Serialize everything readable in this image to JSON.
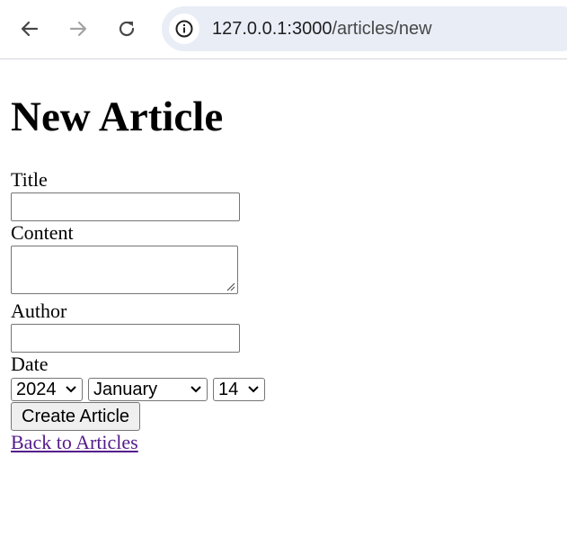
{
  "browser": {
    "url_host": "127.0.0.1:3000",
    "url_path": "/articles/new",
    "icons": {
      "back": "arrow-left-icon",
      "forward": "arrow-right-icon",
      "reload": "reload-icon",
      "site_info": "info-icon"
    }
  },
  "page": {
    "heading": "New Article",
    "form": {
      "title_label": "Title",
      "title_value": "",
      "content_label": "Content",
      "content_value": "",
      "author_label": "Author",
      "author_value": "",
      "date_label": "Date",
      "date_year": "2024",
      "date_month": "January",
      "date_day": "14",
      "submit_label": "Create Article"
    },
    "back_link": "Back to Articles"
  },
  "colors": {
    "link_visited": "#551a8b",
    "omnibox_bg": "#e9edf6",
    "forward_disabled": "#a3a3a3"
  }
}
